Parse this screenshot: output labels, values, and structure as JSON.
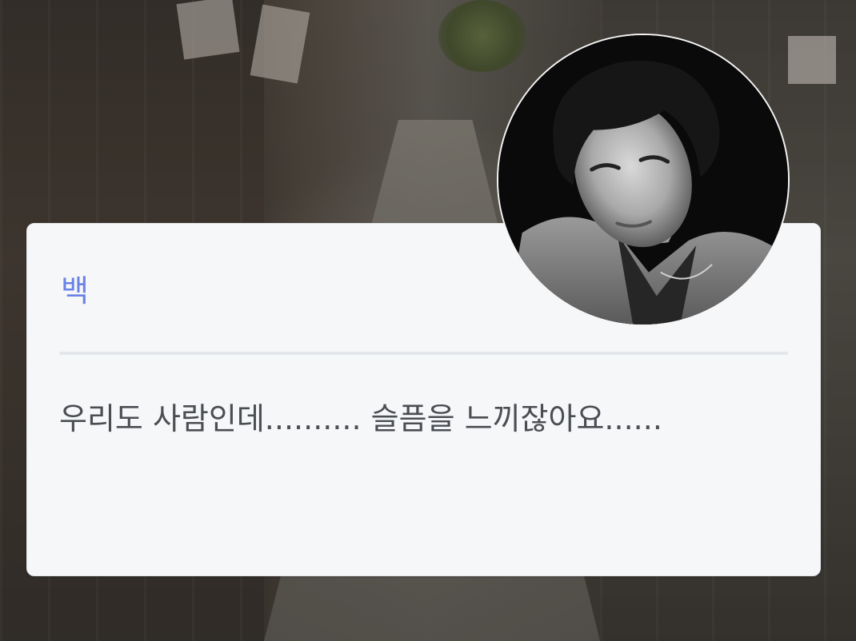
{
  "dialogue_box": {
    "speaker_name": "백",
    "line": "우리도 사람인데.......... 슬픔을 느끼잖아요......",
    "speaker_color": "#6a82e6",
    "text_color": "#4a4d52"
  },
  "avatar": {
    "icon": "character-portrait"
  }
}
